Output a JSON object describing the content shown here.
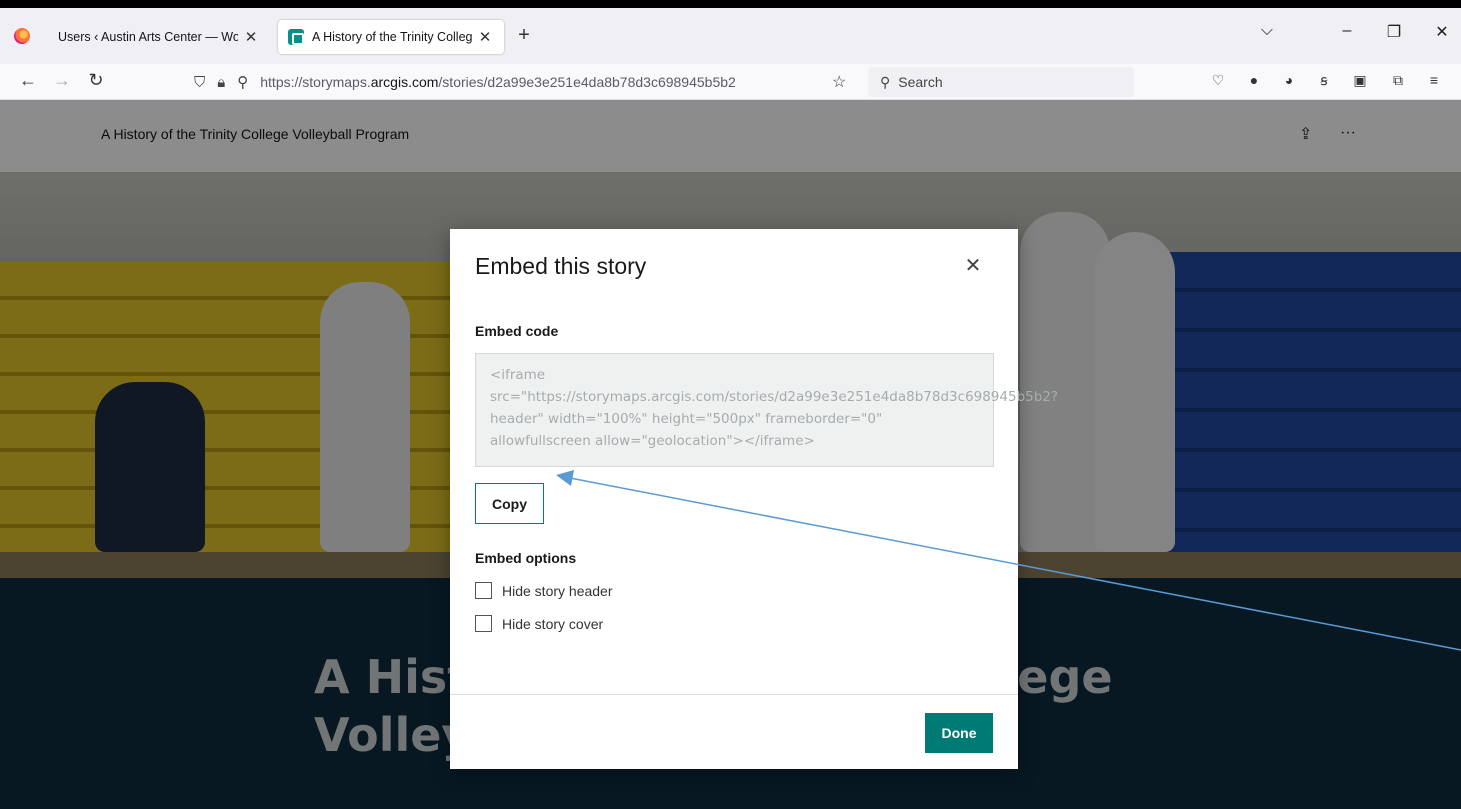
{
  "browser": {
    "tabs": [
      {
        "label": "Users ‹ Austin Arts Center — WordP",
        "close": "✕"
      },
      {
        "label": "A History of the Trinity College",
        "close": "✕"
      }
    ],
    "new_tab": "+",
    "url_prefix": "https://storymaps.",
    "url_domain": "arcgis.com",
    "url_path": "/stories/d2a99e3e251e4da8b78d3c698945b5b2",
    "search_placeholder": "Search"
  },
  "story": {
    "header_title": "A History of the Trinity College Volleyball Program",
    "cover_title": "A History of the Trinity College Volleyball Program"
  },
  "modal": {
    "title": "Embed this story",
    "embed_code_label": "Embed code",
    "embed_code": "<iframe src=\"https://storymaps.arcgis.com/stories/d2a99e3e251e4da8b78d3c698945b5b2?header\" width=\"100%\" height=\"500px\" frameborder=\"0\" allowfullscreen allow=\"geolocation\"></iframe>",
    "copy_label": "Copy",
    "options_label": "Embed options",
    "options": [
      {
        "label": "Hide story header",
        "checked": false
      },
      {
        "label": "Hide story cover",
        "checked": false
      }
    ],
    "done_label": "Done"
  },
  "colors": {
    "accent": "#007a75",
    "annotation_arrow": "#5b9bd5",
    "cover_bottom": "#0d2c3e"
  }
}
